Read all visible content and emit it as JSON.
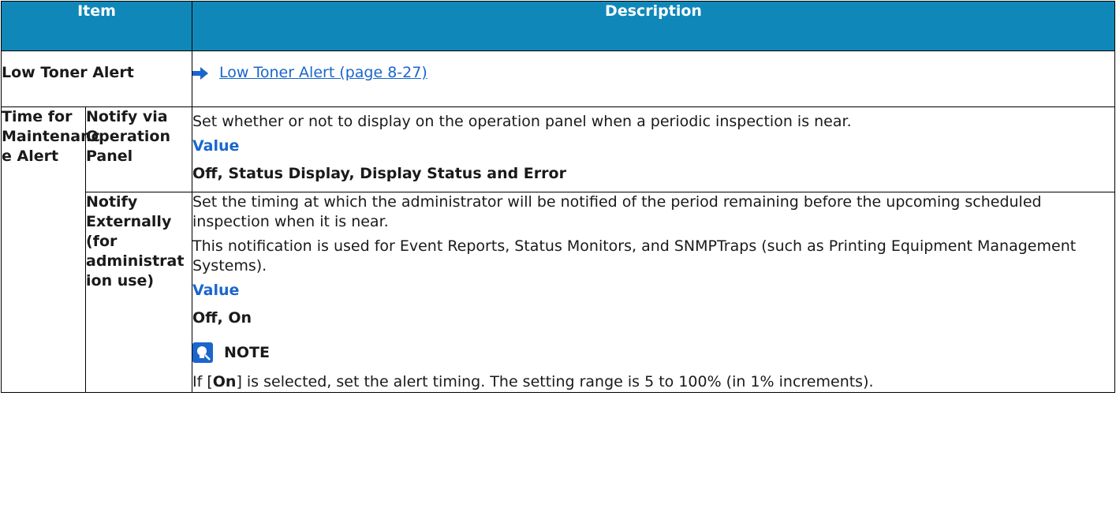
{
  "table": {
    "headers": {
      "item": "Item",
      "description": "Description"
    },
    "rows": {
      "low_toner": {
        "item": "Low Toner Alert",
        "link_text": "Low Toner Alert (page 8-27)",
        "link_icon": "right-arrow-icon"
      },
      "maintenance": {
        "item": "Time for Maintenanc e Alert",
        "notify_panel": {
          "subitem": "Notify via Operation Panel",
          "description": "Set whether or not to display on the operation panel when a periodic inspection is near.",
          "value_label": "Value",
          "value_text": "Off, Status Display, Display Status and Error"
        },
        "notify_external": {
          "subitem": "Notify Externally (for administrat ion use)",
          "description_1": "Set the timing at which the administrator will be notified of the period remaining before the upcoming scheduled inspection when it is near.",
          "description_2": "This notification is used for Event Reports, Status Monitors, and SNMPTraps (such as Printing Equipment Management Systems).",
          "value_label": "Value",
          "value_text": "Off, On",
          "note_label": "NOTE",
          "note_icon": "lightbulb-note-icon",
          "note_prefix": "If [",
          "note_bold": "On",
          "note_suffix": "] is selected, set the alert timing. The setting range is 5 to 100% (in 1% increments)."
        }
      }
    }
  },
  "colors": {
    "header_bg": "#0f88b9",
    "link": "#1a66cc",
    "value_label": "#1a66cc"
  }
}
